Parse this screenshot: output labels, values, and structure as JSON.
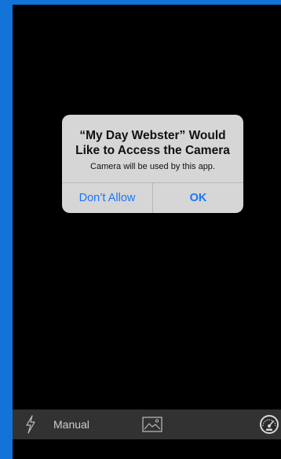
{
  "alert": {
    "title": "“My Day Webster” Would Like to Access the Camera",
    "message": "Camera will be used by this app.",
    "deny_label": "Don’t Allow",
    "confirm_label": "OK"
  },
  "toolbar": {
    "flash_icon": "flash-icon",
    "mode_label": "Manual",
    "gallery_icon": "image-gallery-icon",
    "meter_icon": "speedometer-icon"
  },
  "colors": {
    "frame_accent": "#1273d8",
    "alert_button": "#1b76f5",
    "alert_background": "#d6d6d6",
    "toolbar_background": "#323232"
  }
}
